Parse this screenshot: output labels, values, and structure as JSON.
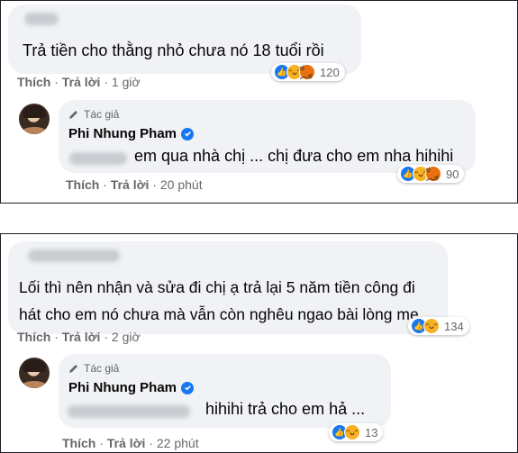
{
  "threads": [
    {
      "comment": {
        "text": "Trả tiền cho thằng nhỏ chưa nó 18 tuổi rồi",
        "reactions": [
          "like-icon",
          "haha-icon",
          "angry-icon"
        ],
        "reaction_count": "120",
        "like_label": "Thích",
        "reply_label": "Trả lời",
        "time": "1 giờ"
      },
      "reply": {
        "author_tag": "Tác giả",
        "author": "Phi Nhung Pham",
        "text": "em qua nhà chị ... chị đưa cho em nha hihihi",
        "reactions": [
          "like-icon",
          "haha-icon",
          "angry-icon"
        ],
        "reaction_count": "90",
        "like_label": "Thích",
        "reply_label": "Trả lời",
        "time": "20 phút"
      }
    },
    {
      "comment": {
        "text_line1": "Lối thì nên nhận và sửa đi chị ạ trả lại 5 năm tiền công đi",
        "text_line2": "hát cho em nó chưa mà vẫn còn nghêu ngao bài lòng mẹ",
        "reactions": [
          "like-icon",
          "haha-icon"
        ],
        "reaction_count": "134",
        "like_label": "Thích",
        "reply_label": "Trả lời",
        "time": "2 giờ"
      },
      "reply": {
        "author_tag": "Tác giả",
        "author": "Phi Nhung Pham",
        "text": "hihihi trả cho em hả ...",
        "reactions": [
          "like-icon",
          "haha-icon"
        ],
        "reaction_count": "13",
        "like_label": "Thích",
        "reply_label": "Trả lời",
        "time": "22 phút"
      }
    }
  ],
  "colors": {
    "bubble": "#f0f2f5",
    "meta_text": "#65676b",
    "like_blue": "#1877f2",
    "haha_yellow": "#f7b125",
    "angry_orange": "#e9710f",
    "frame_border": "#1c1e21"
  }
}
